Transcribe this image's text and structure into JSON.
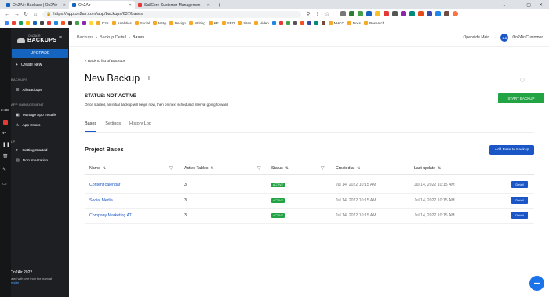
{
  "browser": {
    "tabs": [
      {
        "title": "On2Air: Backups | On2Air",
        "color": "#1565c0",
        "active": false
      },
      {
        "title": "On2Air",
        "color": "#1565c0",
        "active": true
      },
      {
        "title": "SailCore Customer Managemen",
        "color": "#e53935",
        "active": false
      }
    ],
    "new_tab": "+",
    "url": "https://app.on2air.com/app/backups/637/bases",
    "bookmarks": [
      "D2A",
      "Analytics",
      "Social",
      "Mktg",
      "Design",
      "Writing",
      "KE",
      "SEO",
      "Sites",
      "Video",
      "NHCC",
      "Docs",
      "Research"
    ]
  },
  "sidebar": {
    "brand_small": "ON2AIR",
    "brand": "BACKUPS",
    "upgrade": "UPGRADE",
    "create_new": "Create New",
    "section_backups": "BACKUPS",
    "all_backups": "All Backups",
    "section_app_mgmt": "APP MANAGEMENT",
    "manage_installs": "Manage App Installs",
    "app_errors": "App Errors",
    "section_help": "LP",
    "getting_started": "Getting Started",
    "documentation": "Documentation",
    "copyright": "© On2Air 2022",
    "made_with": "Created with love from the team at",
    "made_link": "Openside",
    "strip_time": "2:38"
  },
  "header": {
    "breadcrumb": [
      "Backups",
      "Backup Detail",
      "Bases"
    ],
    "workspace": "Openside Main",
    "avatar_initials": "OC",
    "user": "On2Air Customer"
  },
  "page": {
    "back_link": "Back to list of Backups",
    "title": "New Backup",
    "status": "STATUS: NOT ACTIVE",
    "status_desc": "Once started, an initial backup will begin now, then on next scheduled interval going forward",
    "start_button": "START BACKUP",
    "tabs": [
      "Bases",
      "Settings",
      "History Log"
    ],
    "section_title": "Project Bases",
    "add_button": "Add Base to Backup"
  },
  "table": {
    "columns": [
      "Name",
      "Active Tables",
      "Status",
      "Created at",
      "Last update"
    ],
    "rows": [
      {
        "name": "Content calendar",
        "tables": "3",
        "status": "ACTIVE",
        "created": "Jul 14, 2022 10:15 AM",
        "updated": "Jul 14, 2022 10:15 AM",
        "action": "Detail"
      },
      {
        "name": "Social Media",
        "tables": "3",
        "status": "ACTIVE",
        "created": "Jul 14, 2022 10:15 AM",
        "updated": "Jul 14, 2022 10:15 AM",
        "action": "Detail"
      },
      {
        "name": "Company Marketing AT",
        "tables": "3",
        "status": "ACTIVE",
        "created": "Jul 14, 2022 10:15 AM",
        "updated": "Jul 14, 2022 10:15 AM",
        "action": "Detail"
      }
    ]
  },
  "colors": {
    "primary": "#1a56c5",
    "success": "#22a344",
    "sidebar": "#1e1f22"
  }
}
